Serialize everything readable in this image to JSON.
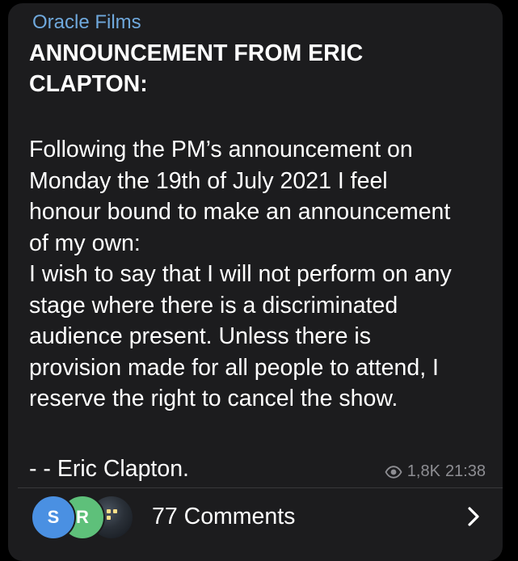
{
  "post": {
    "channel_name": "Oracle Films",
    "title_lines": [
      "ANNOUNCEMENT FROM ERIC",
      "CLAPTON:"
    ],
    "body_lines": [
      "Following the PM’s announcement on",
      "Monday the 19th of July 2021 I feel",
      "honour bound to make an announcement",
      "of my own:",
      "I wish to say that I will not perform on any",
      "stage where there is a discriminated",
      "audience present. Unless there is",
      "provision made for all people to attend, I",
      "reserve the right to cancel the show."
    ],
    "signature": "- - Eric Clapton.",
    "views": "1,8K",
    "time": "21:38",
    "view_icon": "eye-icon"
  },
  "comments": {
    "avatars": [
      {
        "initial": "S",
        "color": "#4a90e2"
      },
      {
        "initial": "R",
        "color": "#5ec07a"
      }
    ],
    "label": "77 Comments",
    "arrow_icon": "chevron-right-icon"
  },
  "colors": {
    "background": "#000000",
    "bubble": "#1c1c1e",
    "channel_name": "#6fa8dc",
    "text": "#ffffff",
    "meta": "#8e8e93"
  }
}
